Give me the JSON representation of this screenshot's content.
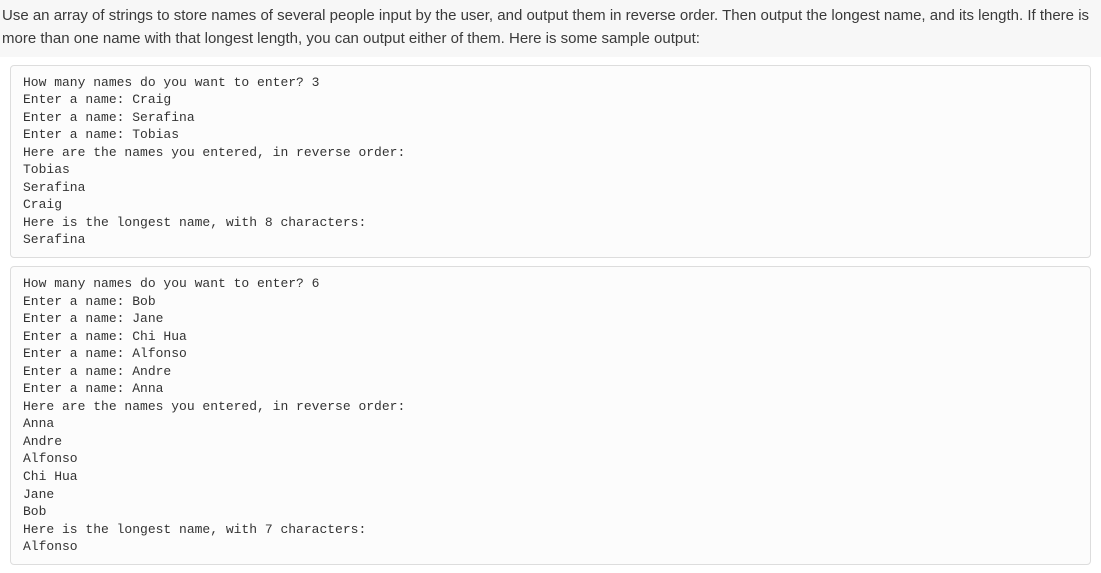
{
  "instructions": "Use an array of strings to store names of several people input by the user, and output them in reverse order. Then output the longest name, and its length.  If there is more than one name with that longest length, you can output either of them. Here is some sample output:",
  "sample1": "How many names do you want to enter? 3\nEnter a name: Craig\nEnter a name: Serafina\nEnter a name: Tobias\nHere are the names you entered, in reverse order:\nTobias\nSerafina\nCraig\nHere is the longest name, with 8 characters:\nSerafina",
  "sample2": "How many names do you want to enter? 6\nEnter a name: Bob\nEnter a name: Jane\nEnter a name: Chi Hua\nEnter a name: Alfonso\nEnter a name: Andre\nEnter a name: Anna\nHere are the names you entered, in reverse order:\nAnna\nAndre\nAlfonso\nChi Hua\nJane\nBob\nHere is the longest name, with 7 characters:\nAlfonso"
}
